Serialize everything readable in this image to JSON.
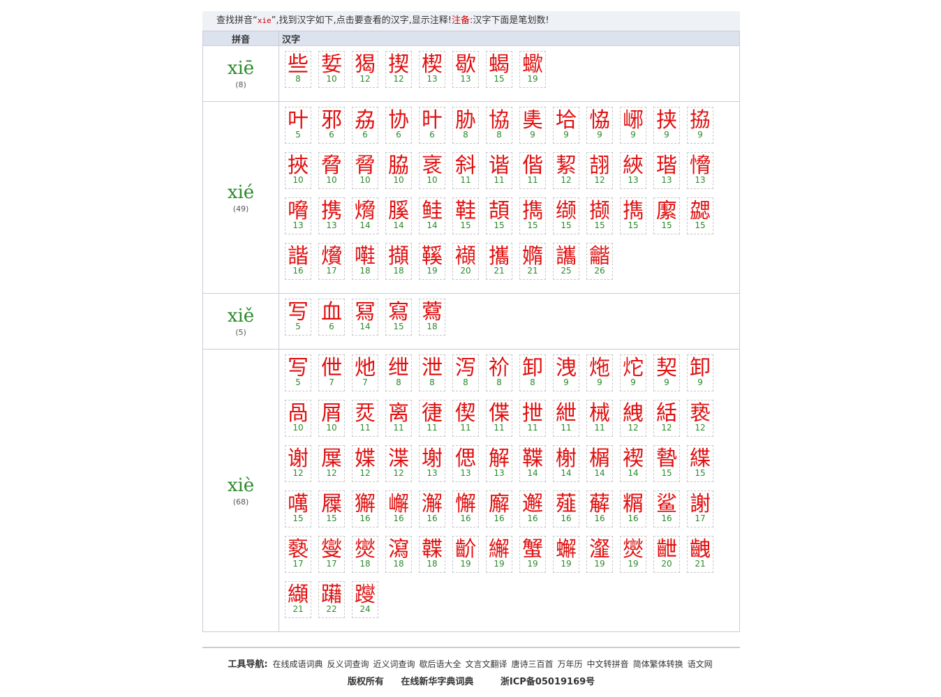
{
  "topbar": {
    "prefix": "查找拼音“",
    "keyword": "xie",
    "suffix": "”,找到汉字如下,点击要查看的汉字,显示注释!",
    "note_label": "注备:",
    "note_text": "汉字下面是笔划数!"
  },
  "table": {
    "col_pinyin": "拼音",
    "col_hanzi": "汉字"
  },
  "groups": [
    {
      "pinyin": "xiē",
      "count": "(8)",
      "chars": [
        {
          "c": "些",
          "s": "8"
        },
        {
          "c": "娎",
          "s": "10"
        },
        {
          "c": "猲",
          "s": "12"
        },
        {
          "c": "揳",
          "s": "12"
        },
        {
          "c": "楔",
          "s": "13"
        },
        {
          "c": "歇",
          "s": "13"
        },
        {
          "c": "蝎",
          "s": "15"
        },
        {
          "c": "蠍",
          "s": "19"
        }
      ]
    },
    {
      "pinyin": "xié",
      "count": "(49)",
      "chars": [
        {
          "c": "叶",
          "s": "5"
        },
        {
          "c": "邪",
          "s": "6"
        },
        {
          "c": "劦",
          "s": "6"
        },
        {
          "c": "协",
          "s": "6"
        },
        {
          "c": "旪",
          "s": "6"
        },
        {
          "c": "胁",
          "s": "8"
        },
        {
          "c": "協",
          "s": "8"
        },
        {
          "c": "奊",
          "s": "9"
        },
        {
          "c": "垥",
          "s": "9"
        },
        {
          "c": "恊",
          "s": "9"
        },
        {
          "c": "峫",
          "s": "9"
        },
        {
          "c": "挟",
          "s": "9"
        },
        {
          "c": "拹",
          "s": "9"
        },
        {
          "c": "挾",
          "s": "10"
        },
        {
          "c": "脅",
          "s": "10"
        },
        {
          "c": "脋",
          "s": "10"
        },
        {
          "c": "脇",
          "s": "10"
        },
        {
          "c": "衺",
          "s": "10"
        },
        {
          "c": "斜",
          "s": "11"
        },
        {
          "c": "谐",
          "s": "11"
        },
        {
          "c": "偕",
          "s": "11"
        },
        {
          "c": "絜",
          "s": "12"
        },
        {
          "c": "翓",
          "s": "12"
        },
        {
          "c": "綊",
          "s": "13"
        },
        {
          "c": "瑎",
          "s": "13"
        },
        {
          "c": "愶",
          "s": "13"
        },
        {
          "c": "嗋",
          "s": "13"
        },
        {
          "c": "携",
          "s": "13"
        },
        {
          "c": "熁",
          "s": "14"
        },
        {
          "c": "膎",
          "s": "14"
        },
        {
          "c": "鲑",
          "s": "14"
        },
        {
          "c": "鞋",
          "s": "15"
        },
        {
          "c": "頡",
          "s": "15"
        },
        {
          "c": "擕",
          "s": "15"
        },
        {
          "c": "缬",
          "s": "15"
        },
        {
          "c": "撷",
          "s": "15"
        },
        {
          "c": "擕",
          "s": "15"
        },
        {
          "c": "緳",
          "s": "15"
        },
        {
          "c": "勰",
          "s": "15"
        },
        {
          "c": "諧",
          "s": "16"
        },
        {
          "c": "燲",
          "s": "17"
        },
        {
          "c": "嚡",
          "s": "18"
        },
        {
          "c": "擷",
          "s": "18"
        },
        {
          "c": "鞵",
          "s": "19"
        },
        {
          "c": "襭",
          "s": "20"
        },
        {
          "c": "攜",
          "s": "21"
        },
        {
          "c": "嫷",
          "s": "21"
        },
        {
          "c": "讗",
          "s": "25"
        },
        {
          "c": "龤",
          "s": "26"
        }
      ]
    },
    {
      "pinyin": "xiě",
      "count": "(5)",
      "chars": [
        {
          "c": "写",
          "s": "5"
        },
        {
          "c": "血",
          "s": "6"
        },
        {
          "c": "冩",
          "s": "14"
        },
        {
          "c": "寫",
          "s": "15"
        },
        {
          "c": "藛",
          "s": "18"
        }
      ]
    },
    {
      "pinyin": "xiè",
      "count": "(68)",
      "chars": [
        {
          "c": "写",
          "s": "5"
        },
        {
          "c": "伳",
          "s": "7"
        },
        {
          "c": "灺",
          "s": "7"
        },
        {
          "c": "绁",
          "s": "8"
        },
        {
          "c": "泄",
          "s": "8"
        },
        {
          "c": "泻",
          "s": "8"
        },
        {
          "c": "祄",
          "s": "8"
        },
        {
          "c": "卸",
          "s": "8"
        },
        {
          "c": "洩",
          "s": "9"
        },
        {
          "c": "炧",
          "s": "9"
        },
        {
          "c": "炨",
          "s": "9"
        },
        {
          "c": "契",
          "s": "9"
        },
        {
          "c": "卸",
          "s": "9"
        },
        {
          "c": "咼",
          "s": "10"
        },
        {
          "c": "屑",
          "s": "10"
        },
        {
          "c": "烎",
          "s": "11"
        },
        {
          "c": "离",
          "s": "11"
        },
        {
          "c": "徢",
          "s": "11"
        },
        {
          "c": "偰",
          "s": "11"
        },
        {
          "c": "偞",
          "s": "11"
        },
        {
          "c": "抴",
          "s": "11"
        },
        {
          "c": "紲",
          "s": "11"
        },
        {
          "c": "械",
          "s": "11"
        },
        {
          "c": "絏",
          "s": "12"
        },
        {
          "c": "絬",
          "s": "12"
        },
        {
          "c": "亵",
          "s": "12"
        },
        {
          "c": "谢",
          "s": "12"
        },
        {
          "c": "屟",
          "s": "12"
        },
        {
          "c": "媟",
          "s": "12"
        },
        {
          "c": "渫",
          "s": "12"
        },
        {
          "c": "塮",
          "s": "13"
        },
        {
          "c": "偲",
          "s": "13"
        },
        {
          "c": "解",
          "s": "13"
        },
        {
          "c": "鞢",
          "s": "14"
        },
        {
          "c": "榭",
          "s": "14"
        },
        {
          "c": "榍",
          "s": "14"
        },
        {
          "c": "褉",
          "s": "14"
        },
        {
          "c": "暬",
          "s": "15"
        },
        {
          "c": "緤",
          "s": "15"
        },
        {
          "c": "噧",
          "s": "15"
        },
        {
          "c": "屧",
          "s": "15"
        },
        {
          "c": "獬",
          "s": "16"
        },
        {
          "c": "嶰",
          "s": "16"
        },
        {
          "c": "澥",
          "s": "16"
        },
        {
          "c": "懈",
          "s": "16"
        },
        {
          "c": "廨",
          "s": "16"
        },
        {
          "c": "邂",
          "s": "16"
        },
        {
          "c": "薤",
          "s": "16"
        },
        {
          "c": "薢",
          "s": "16"
        },
        {
          "c": "糏",
          "s": "16"
        },
        {
          "c": "鲨",
          "s": "16"
        },
        {
          "c": "謝",
          "s": "17"
        },
        {
          "c": "褻",
          "s": "17"
        },
        {
          "c": "燮",
          "s": "17"
        },
        {
          "c": "爕",
          "s": "18"
        },
        {
          "c": "瀉",
          "s": "18"
        },
        {
          "c": "韘",
          "s": "18"
        },
        {
          "c": "齘",
          "s": "19"
        },
        {
          "c": "繲",
          "s": "19"
        },
        {
          "c": "蟹",
          "s": "19"
        },
        {
          "c": "蠏",
          "s": "19"
        },
        {
          "c": "瀣",
          "s": "19"
        },
        {
          "c": "爕",
          "s": "19"
        },
        {
          "c": "齛",
          "s": "20"
        },
        {
          "c": "齥",
          "s": "21"
        },
        {
          "c": "纈",
          "s": "21"
        },
        {
          "c": "躤",
          "s": "22"
        },
        {
          "c": "躞",
          "s": "24"
        }
      ]
    }
  ],
  "footer": {
    "nav_label": "工具导航:",
    "nav_links": [
      "在线成语词典",
      "反义词查询",
      "近义词查询",
      "歇后语大全",
      "文言文翻译",
      "唐诗三百首",
      "万年历",
      "中文转拼音",
      "简体繁体转换",
      "语文网"
    ],
    "copyright": "版权所有",
    "site_name": "在线新华字典词典",
    "icp": "浙ICP备05019169号"
  }
}
